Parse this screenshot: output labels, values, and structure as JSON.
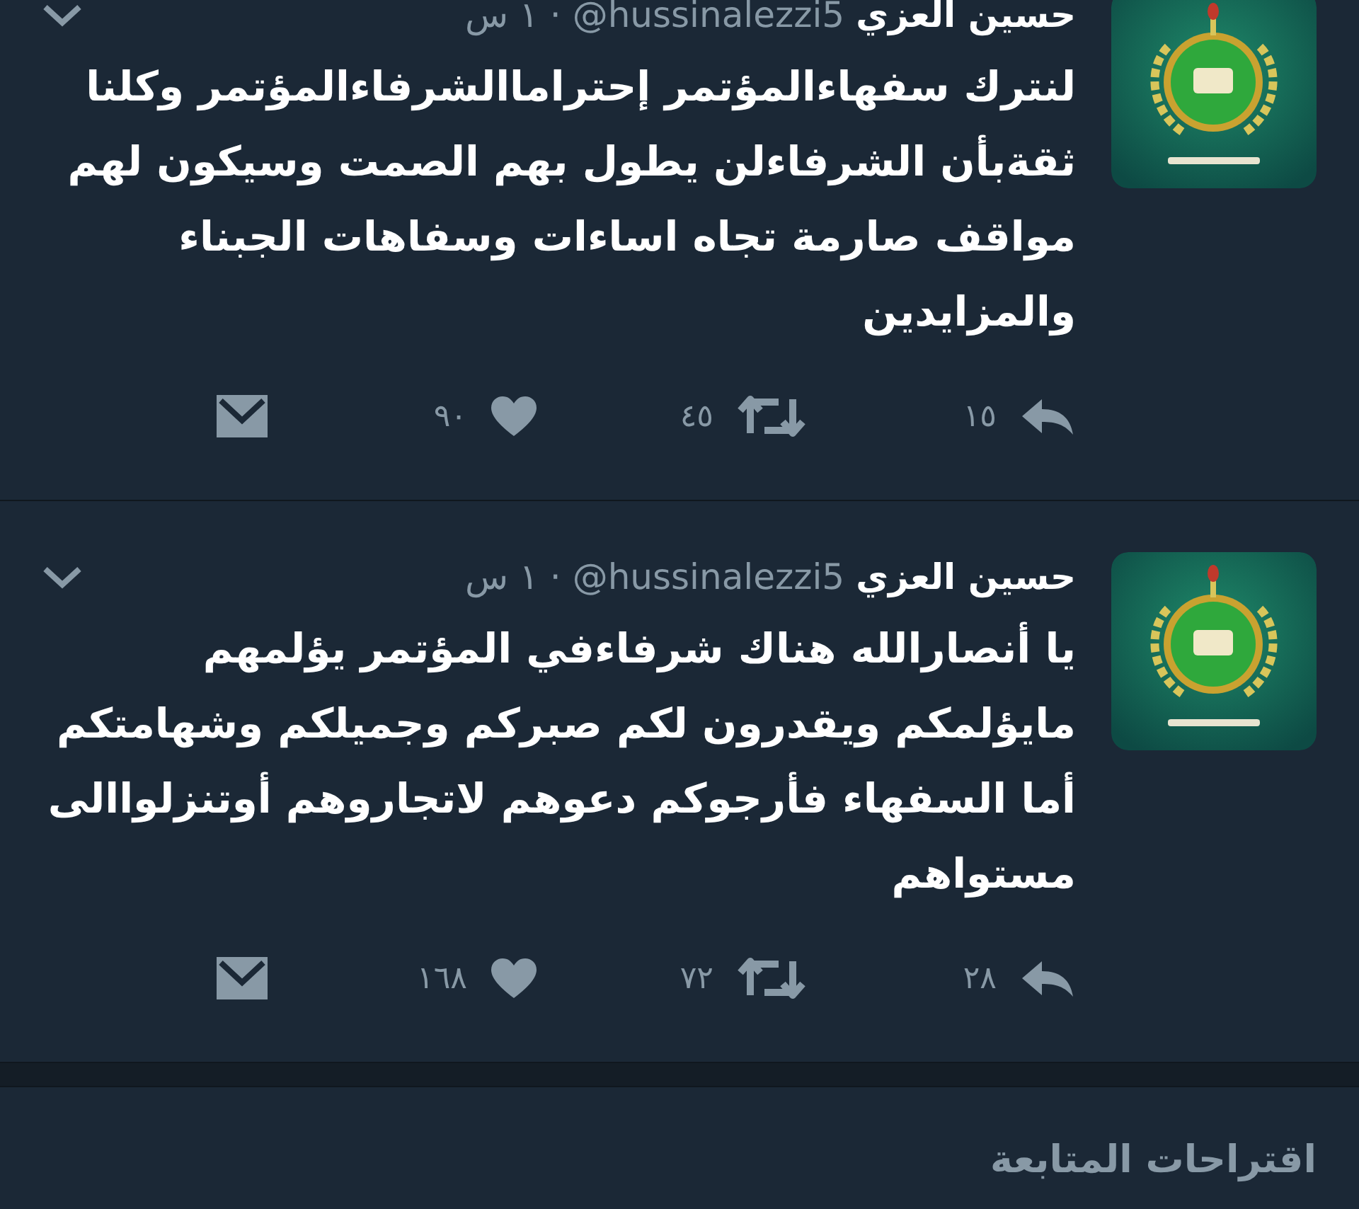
{
  "tweets": [
    {
      "author": "حسين العزي",
      "handle": "@hussinalezzi5",
      "separator": "·",
      "time": "١ س",
      "text": "لنترك سفهاءالمؤتمر إحتراماالشرفاءالمؤتمر وكلنا ثقةبأن الشرفاءلن يطول بهم الصمت وسيكون لهم مواقف صارمة تجاه اساءات وسفاهات الجبناء والمزايدين",
      "replies": "١٥",
      "retweets": "٤٥",
      "likes": "٩٠"
    },
    {
      "author": "حسين العزي",
      "handle": "@hussinalezzi5",
      "separator": "·",
      "time": "١ س",
      "text": "يا أنصارالله هناك شرفاءفي المؤتمر يؤلمهم مايؤلمكم ويقدرون لكم صبركم وجميلكم وشهامتكم أما السفهاء فأرجوكم دعوهم لاتجاروهم أوتنزلواالى مستواهم",
      "replies": "٢٨",
      "retweets": "٧٢",
      "likes": "١٦٨"
    }
  ],
  "section": {
    "title": "اقتراحات المتابعة"
  }
}
